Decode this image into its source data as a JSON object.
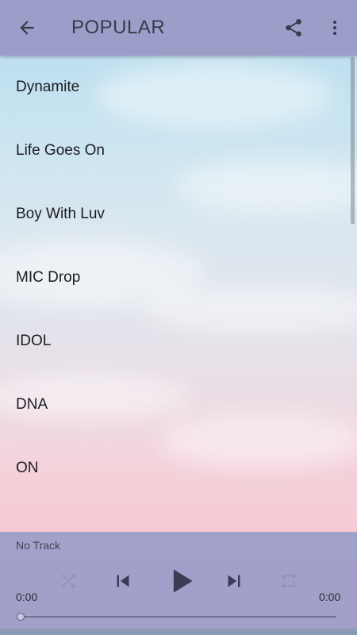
{
  "app": {
    "title": "POPULAR"
  },
  "icons": {
    "back": "arrow-back-icon",
    "share": "share-icon",
    "more": "more-vert-icon",
    "shuffle": "shuffle-icon",
    "previous": "skip-previous-icon",
    "play": "play-icon",
    "next": "skip-next-icon",
    "repeat": "repeat-icon"
  },
  "colors": {
    "toolbar": "#9b9ec8",
    "player": "#969bc8",
    "text": "#1c1c22",
    "disabled_icon": "#8f93bc"
  },
  "tracks": [
    {
      "title": "Dynamite"
    },
    {
      "title": "Life Goes On"
    },
    {
      "title": "Boy With Luv"
    },
    {
      "title": "MIC Drop"
    },
    {
      "title": "IDOL"
    },
    {
      "title": "DNA"
    },
    {
      "title": "ON"
    }
  ],
  "player": {
    "now_playing": "No Track",
    "elapsed": "0:00",
    "duration": "0:00",
    "progress": 0
  }
}
